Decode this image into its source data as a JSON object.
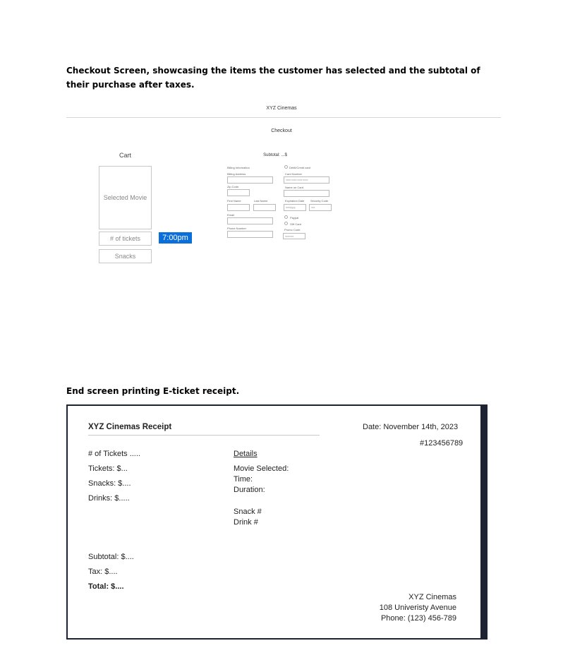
{
  "headings": {
    "checkout": "Checkout Screen, showcasing the items the customer has selected and the subtotal of their purchase after taxes.",
    "end": "End screen printing E-ticket receipt."
  },
  "checkout": {
    "app_title": "XYZ Cinemas",
    "page_title": "Checkout",
    "cart_label": "Cart",
    "selected_movie": "Selected Movie",
    "tickets_placeholder": "# of tickets",
    "snacks_label": "Snacks",
    "showtime": "7:00pm",
    "subtotal": "Subtotal: ...$",
    "billing": {
      "section_label": "Billing Information",
      "billing_address": "Billing Address",
      "zip_code": "Zip Code",
      "first_name": "First Name",
      "last_name": "Last Name",
      "email": "Email",
      "phone_number": "Phone Number"
    },
    "payment": {
      "debit_credit": "Debit/Credit card",
      "card_number": "Card Number",
      "card_placeholder": "xxxx-xxxx-xxxx-xxxx",
      "name_on_card": "Name on Card",
      "expiration_date": "Expiration Date",
      "security_code": "Security Code",
      "exp_placeholder": "mm/yyyy",
      "sec_placeholder": "xxx",
      "paypal": "Paypal",
      "gift_card": "Gift Card",
      "promo_code": "Promo Code",
      "promo_placeholder": "xxxxxxx"
    }
  },
  "receipt": {
    "title": "XYZ Cinemas Receipt",
    "date": "Date: November 14th, 2023",
    "order_number": "#123456789",
    "lines": [
      "# of Tickets .....",
      "Tickets: $...",
      "Snacks: $....",
      "Drinks: $....."
    ],
    "details_heading": "Details",
    "details": {
      "movie": "Movie Selected:",
      "time": "Time:",
      "duration": "Duration:",
      "snack": "Snack #",
      "drink": "Drink #"
    },
    "subtotal": "Subtotal: $....",
    "tax": "Tax: $....",
    "total": "Total: $....",
    "footer": {
      "name": "XYZ Cinemas",
      "address": "108 Univeristy Avenue",
      "phone": "Phone: (123) 456-789"
    }
  }
}
